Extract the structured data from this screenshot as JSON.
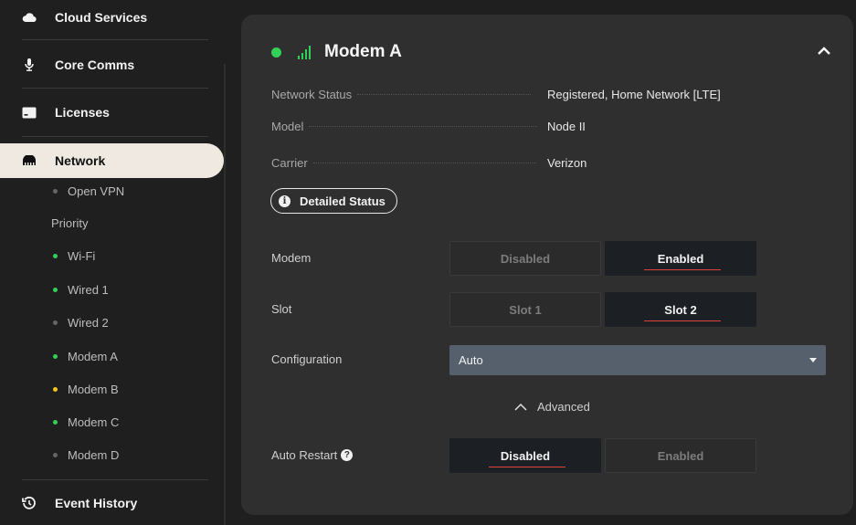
{
  "sidebar": {
    "items": [
      {
        "label": "Cloud Services",
        "icon": "cloud-icon"
      },
      {
        "label": "Core Comms",
        "icon": "microphone-icon"
      },
      {
        "label": "Licenses",
        "icon": "license-icon"
      },
      {
        "label": "Network",
        "icon": "router-icon"
      },
      {
        "label": "Event History",
        "icon": "history-icon"
      }
    ],
    "sub_items": [
      {
        "label": "Open VPN",
        "status": "inactive"
      },
      {
        "label": "Wi-Fi",
        "status": "green"
      },
      {
        "label": "Wired 1",
        "status": "green"
      },
      {
        "label": "Wired 2",
        "status": "inactive"
      },
      {
        "label": "Modem A",
        "status": "green"
      },
      {
        "label": "Modem B",
        "status": "yellow"
      },
      {
        "label": "Modem C",
        "status": "green"
      },
      {
        "label": "Modem D",
        "status": "inactive"
      }
    ],
    "priority_label": "Priority"
  },
  "card": {
    "title": "Modem A",
    "status_color": "#31d158",
    "details": [
      {
        "key": "Network Status",
        "value": "Registered, Home Network [LTE]"
      },
      {
        "key": "Model",
        "value": "Node II"
      },
      {
        "key": "Carrier",
        "value": "Verizon"
      }
    ],
    "detailed_status_label": "Detailed Status",
    "modem": {
      "label": "Modem",
      "options": [
        "Disabled",
        "Enabled"
      ],
      "selected": "Enabled"
    },
    "slot": {
      "label": "Slot",
      "options": [
        "Slot 1",
        "Slot 2"
      ],
      "selected": "Slot 2"
    },
    "configuration": {
      "label": "Configuration",
      "value": "Auto"
    },
    "advanced_label": "Advanced",
    "auto_restart": {
      "label": "Auto Restart",
      "options": [
        "Disabled",
        "Enabled"
      ],
      "selected": "Disabled"
    }
  },
  "colors": {
    "accent_green": "#31d158",
    "accent_yellow": "#f5c518",
    "underline_red": "#e04040",
    "select_bg": "#56606d"
  }
}
